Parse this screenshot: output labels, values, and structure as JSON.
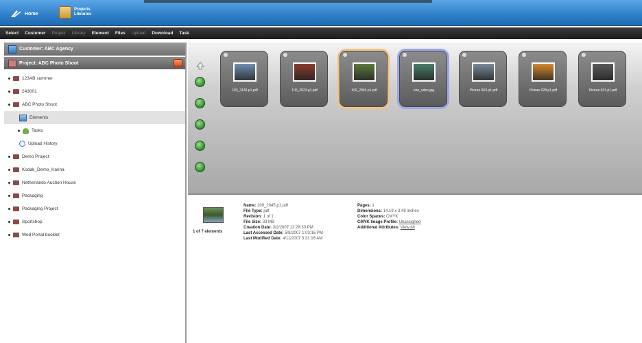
{
  "topbar": {
    "home_label": "Home",
    "projects_label_1": "Projects",
    "projects_label_2": "Libraries"
  },
  "menu": {
    "items": [
      {
        "label": "Select",
        "dim": false
      },
      {
        "label": "Customer",
        "dim": false
      },
      {
        "label": "Project",
        "dim": true
      },
      {
        "label": "Library",
        "dim": true
      },
      {
        "label": "Element",
        "dim": false
      },
      {
        "label": "Files",
        "dim": false
      },
      {
        "label": "Upload",
        "dim": true
      },
      {
        "label": "Download",
        "dim": false
      },
      {
        "label": "Task",
        "dim": false
      }
    ]
  },
  "sidebar": {
    "customer_header": "Customer: ABC Agency",
    "project_header": "Project: ABC Photo Shoot",
    "tree": [
      {
        "label": "123AB summer",
        "level": 1,
        "icon": "group"
      },
      {
        "label": "243001",
        "level": 1,
        "icon": "group"
      },
      {
        "label": "ABC Photo Shoot",
        "level": 1,
        "icon": "group"
      },
      {
        "label": "Elements",
        "level": 3,
        "icon": "elements",
        "selected": true
      },
      {
        "label": "Tasks",
        "level": 2,
        "icon": "tasks"
      },
      {
        "label": "Upload History",
        "level": 3,
        "icon": "history"
      },
      {
        "label": "Demo Project",
        "level": 1,
        "icon": "group"
      },
      {
        "label": "Kodak_Demo_Karina",
        "level": 1,
        "icon": "group"
      },
      {
        "label": "Netherlands Auction House",
        "level": 1,
        "icon": "group"
      },
      {
        "label": "Packaging",
        "level": 1,
        "icon": "group"
      },
      {
        "label": "Packaging Project",
        "level": 1,
        "icon": "group"
      },
      {
        "label": "Sportshop",
        "level": 1,
        "icon": "group"
      },
      {
        "label": "Wed Portal booklet",
        "level": 1,
        "icon": "group"
      }
    ]
  },
  "gallery": {
    "thumbs": [
      {
        "caption": "103_3136.p1.pdf",
        "selected": "",
        "img": "#6f8fb0"
      },
      {
        "caption": "100_2023.p1.pdf",
        "selected": "",
        "img": "#8a3a2a"
      },
      {
        "caption": "100_2045.p1.pdf",
        "selected": "orange",
        "img": "#5b7a3d"
      },
      {
        "caption": "ebe_vdeo.jpg",
        "selected": "blue",
        "img": "#4a7f6a"
      },
      {
        "caption": "Picture 063.p1.pdf",
        "selected": "",
        "img": "#7a8a9a"
      },
      {
        "caption": "Picture 028.p1.pdf",
        "selected": "",
        "img": "#d58a2e"
      },
      {
        "caption": "Picture 031.p1.pdf",
        "selected": "",
        "img": "#5a5a5a"
      }
    ]
  },
  "details": {
    "count": "1 of 7 elements",
    "left": [
      {
        "k": "Name:",
        "v": "100_2045.p1.pdf"
      },
      {
        "k": "File Type:",
        "v": "pdf"
      },
      {
        "k": "Revision:",
        "v": "1 of 1"
      },
      {
        "k": "File Size:",
        "v": "33 MB"
      },
      {
        "k": "Creation Date:",
        "v": "3/2/2007 12:28:33 PM"
      },
      {
        "k": "Last Accessed Date:",
        "v": "5/8/2007 1:03:16 PM"
      },
      {
        "k": "Last Modified Date:",
        "v": "4/11/2007 3:31:16 AM"
      }
    ],
    "right": [
      {
        "k": "Pages:",
        "v": "1",
        "link": false
      },
      {
        "k": "Dimensions:",
        "v": "14.19 x 3.49 inches",
        "link": false
      },
      {
        "k": "Color Spaces:",
        "v": "CMYK",
        "link": false
      },
      {
        "k": "CMYK Image Profile:",
        "v": "Unassigned",
        "link": true
      },
      {
        "k": "Additional Attributes:",
        "v": "View All",
        "link": true
      }
    ]
  }
}
